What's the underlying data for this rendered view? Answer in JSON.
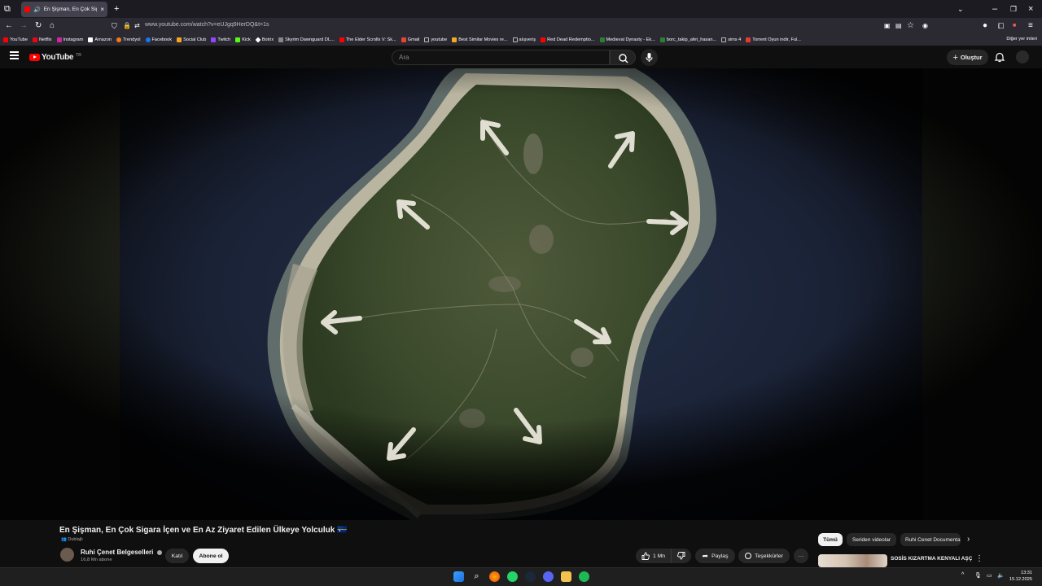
{
  "browser": {
    "tab_title": "En Şişman, En Çok Sigara İ...",
    "url": "www.youtube.com/watch?v=eUJgq9HerDQ&t=1s",
    "bookmarks": [
      {
        "label": "YouTube",
        "color": "#ff0000"
      },
      {
        "label": "Netflix",
        "color": "#e50914"
      },
      {
        "label": "Instagram",
        "color": "#d6249f"
      },
      {
        "label": "Amazon",
        "color": "#ffffff"
      },
      {
        "label": "Trendyol",
        "color": "#f27a1a"
      },
      {
        "label": "Facebook",
        "color": "#1877f2"
      },
      {
        "label": "Social Club",
        "color": "#f5a623"
      },
      {
        "label": "Twitch",
        "color": "#9146ff"
      },
      {
        "label": "Kick",
        "color": "#53fc18"
      },
      {
        "label": "Botrix",
        "color": "#ffffff"
      },
      {
        "label": "Skyrim Dawnguard DL...",
        "color": "#888888"
      },
      {
        "label": "The Elder Scrolls V: Sk...",
        "color": "#ff0000"
      },
      {
        "label": "Gmail",
        "color": "#ea4335"
      },
      {
        "label": "youtube",
        "color": "#bbbbbb"
      },
      {
        "label": "Best Similar Movies re...",
        "color": "#f5a623"
      },
      {
        "label": "alışveriş",
        "color": "#bbbbbb"
      },
      {
        "label": "Red Dead Redemptio...",
        "color": "#ff0000"
      },
      {
        "label": "Medieval Dynasty - Ek...",
        "color": "#2e7d32"
      },
      {
        "label": "borc_takip_afet_hasan...",
        "color": "#2e7d32"
      },
      {
        "label": "sims 4",
        "color": "#bbbbbb"
      },
      {
        "label": "Torrent Oyun indir, Ful...",
        "color": "#e53935"
      }
    ],
    "other_bookmarks": "Diğer yer imleri"
  },
  "youtube": {
    "logo_text": "YouTube",
    "country_code": "TR",
    "search_placeholder": "Ara",
    "create_label": "Oluştur"
  },
  "video": {
    "title": "En Şişman, En Çok Sigara İçen ve En Az Ziyaret Edilen Ülkeye Yolculuk 🇳🇷",
    "dub_label": "Dublajlı",
    "channel_name": "Ruhi Çenet Belgeselleri",
    "verified_icon": "verified-check-icon",
    "subscribers": "16,8 Mn abone",
    "join_label": "Katıl",
    "subscribe_label": "Abone ol",
    "like_count": "1 Mn",
    "share_label": "Paylaş",
    "thanks_label": "Teşekkürler"
  },
  "sidebar": {
    "chips": [
      "Tümü",
      "Seriden videolar",
      "Ruhi Cenet Documentaries"
    ],
    "rec_title": "SOSİS KIZARTMA KENYALI AŞÇI"
  },
  "taskbar": {
    "time": "13:31",
    "date": "15.12.2025"
  }
}
